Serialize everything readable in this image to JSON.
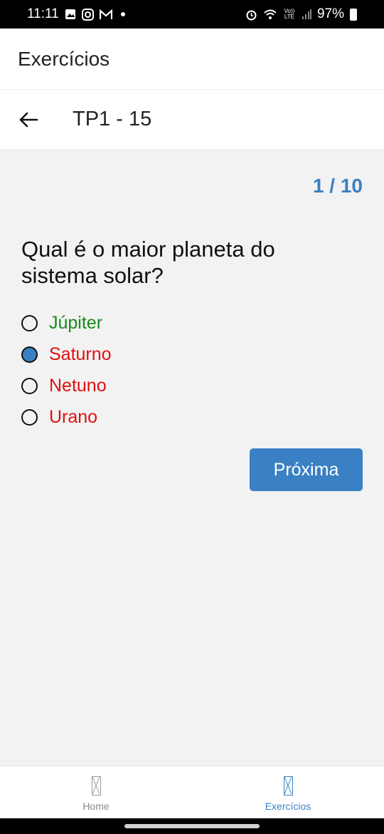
{
  "status": {
    "time": "11:11",
    "battery": "97%",
    "left_icons": [
      "image-icon",
      "instagram-icon",
      "gmail-icon"
    ],
    "right_icons": [
      "alarm-icon",
      "wifi-icon",
      "volte-icon",
      "signal-icon"
    ],
    "volte_text": "Vo)) LTE"
  },
  "app_bar": {
    "title": "Exercícios"
  },
  "sub_header": {
    "title": "TP1 - 15"
  },
  "quiz": {
    "counter": "1 / 10",
    "question": "Qual é o maior planeta do sistema solar?",
    "options": [
      {
        "label": "Júpiter",
        "state": "correct",
        "selected": false
      },
      {
        "label": "Saturno",
        "state": "wrong",
        "selected": true
      },
      {
        "label": "Netuno",
        "state": "wrong",
        "selected": false
      },
      {
        "label": "Urano",
        "state": "wrong",
        "selected": false
      }
    ],
    "next_label": "Próxima"
  },
  "colors": {
    "accent": "#3a80c4",
    "correct": "#1a8a1a",
    "wrong": "#e01010"
  },
  "bottom_nav": {
    "items": [
      {
        "label": "Home",
        "icon": "home-icon",
        "active": false
      },
      {
        "label": "Exercícios",
        "icon": "exercises-icon",
        "active": true
      }
    ]
  }
}
